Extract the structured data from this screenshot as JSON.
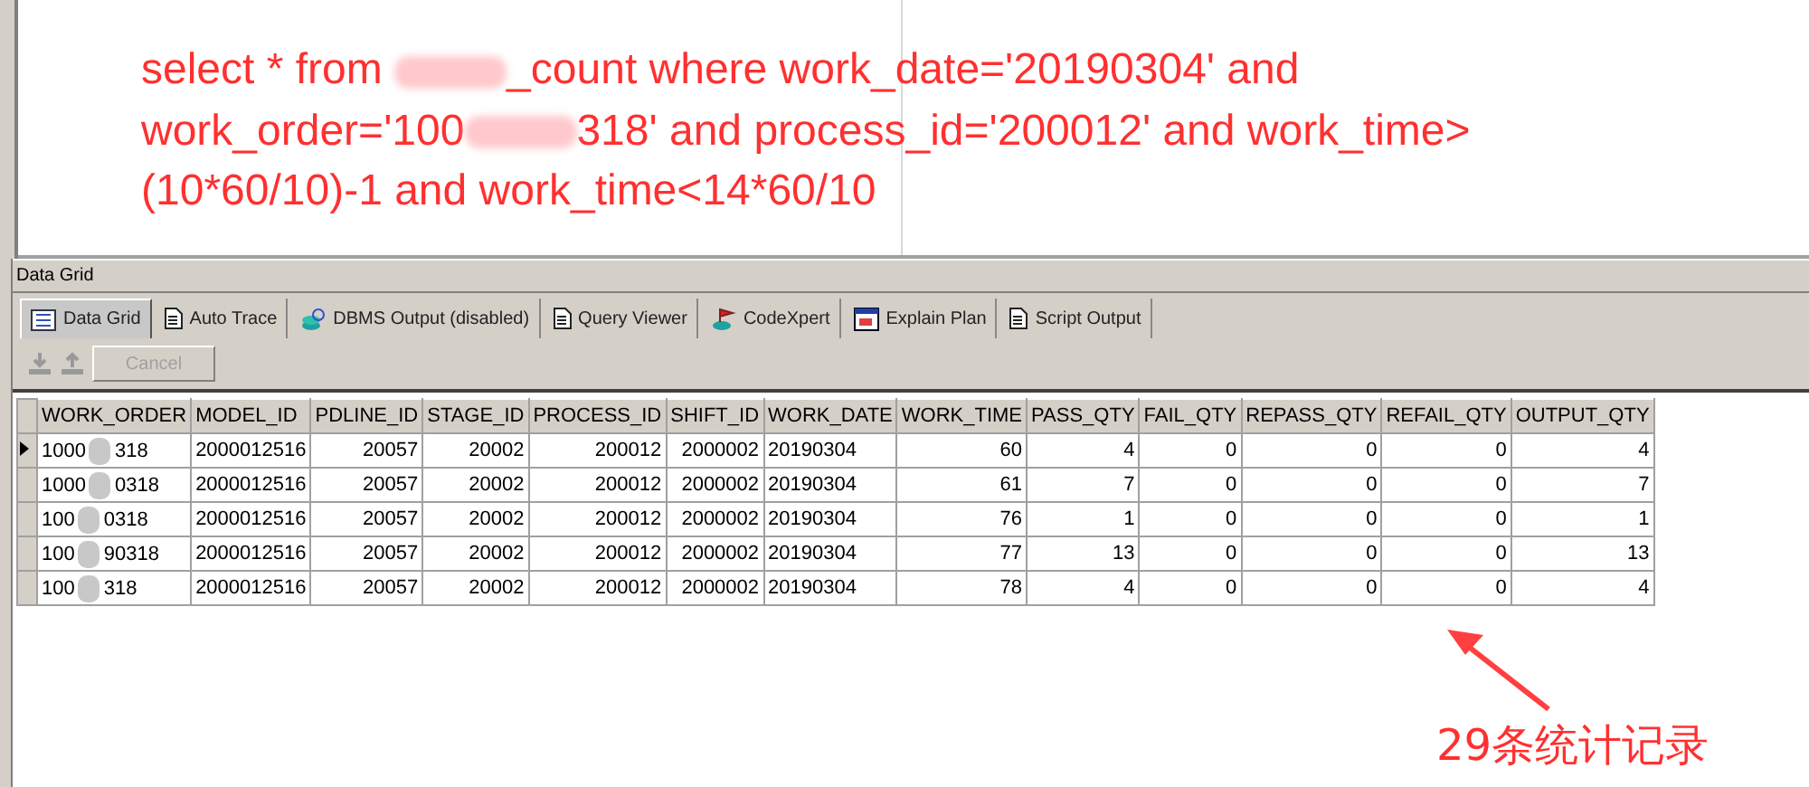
{
  "editor": {
    "sql_lines": [
      [
        {
          "kind": "text",
          "text": "select * from "
        },
        {
          "kind": "redacted"
        },
        {
          "kind": "text",
          "text": "_count where work_date='20190304' and"
        }
      ],
      [
        {
          "kind": "text",
          "text": "work_order='100"
        },
        {
          "kind": "redacted"
        },
        {
          "kind": "text",
          "text": "318' and process_id='200012' and work_time>"
        }
      ],
      [
        {
          "kind": "text",
          "text": "(10*60/10)-1 and work_time<14*60/10"
        }
      ]
    ]
  },
  "panel_title": "Data Grid",
  "tabs": [
    {
      "label": "Data Grid",
      "kind": "grid",
      "selected": true
    },
    {
      "label": "Auto Trace",
      "kind": "doc",
      "selected": false
    },
    {
      "label": "DBMS Output (disabled)",
      "kind": "db",
      "selected": false
    },
    {
      "label": "Query Viewer",
      "kind": "doc",
      "selected": false
    },
    {
      "label": "CodeXpert",
      "kind": "flag",
      "selected": false
    },
    {
      "label": "Explain Plan",
      "kind": "plan",
      "selected": false
    },
    {
      "label": "Script Output",
      "kind": "doc",
      "selected": false
    }
  ],
  "toolbar": {
    "cancel": {
      "label": "Cancel",
      "disabled": true
    }
  },
  "grid": {
    "columns": [
      "WORK_ORDER",
      "MODEL_ID",
      "PDLINE_ID",
      "STAGE_ID",
      "PROCESS_ID",
      "SHIFT_ID",
      "WORK_DATE",
      "WORK_TIME",
      "PASS_QTY",
      "FAIL_QTY",
      "REPASS_QTY",
      "REFAIL_QTY",
      "OUTPUT_QTY"
    ],
    "rows": [
      {
        "current": true,
        "cells": [
          [
            "1000",
            "318"
          ],
          "2000012516",
          "20057",
          "20002",
          "200012",
          "2000002",
          "20190304",
          "60",
          "4",
          "0",
          "0",
          "0",
          "4"
        ]
      },
      {
        "current": false,
        "cells": [
          [
            "1000",
            "0318"
          ],
          "2000012516",
          "20057",
          "20002",
          "200012",
          "2000002",
          "20190304",
          "61",
          "7",
          "0",
          "0",
          "0",
          "7"
        ]
      },
      {
        "current": false,
        "cells": [
          [
            "100",
            "0318"
          ],
          "2000012516",
          "20057",
          "20002",
          "200012",
          "2000002",
          "20190304",
          "76",
          "1",
          "0",
          "0",
          "0",
          "1"
        ]
      },
      {
        "current": false,
        "cells": [
          [
            "100",
            "90318"
          ],
          "2000012516",
          "20057",
          "20002",
          "200012",
          "2000002",
          "20190304",
          "77",
          "13",
          "0",
          "0",
          "0",
          "13"
        ]
      },
      {
        "current": false,
        "cells": [
          [
            "100",
            "318"
          ],
          "2000012516",
          "20057",
          "20002",
          "200012",
          "2000002",
          "20190304",
          "78",
          "4",
          "0",
          "0",
          "0",
          "4"
        ]
      }
    ]
  },
  "annotation": {
    "text": "29条统计记录"
  }
}
